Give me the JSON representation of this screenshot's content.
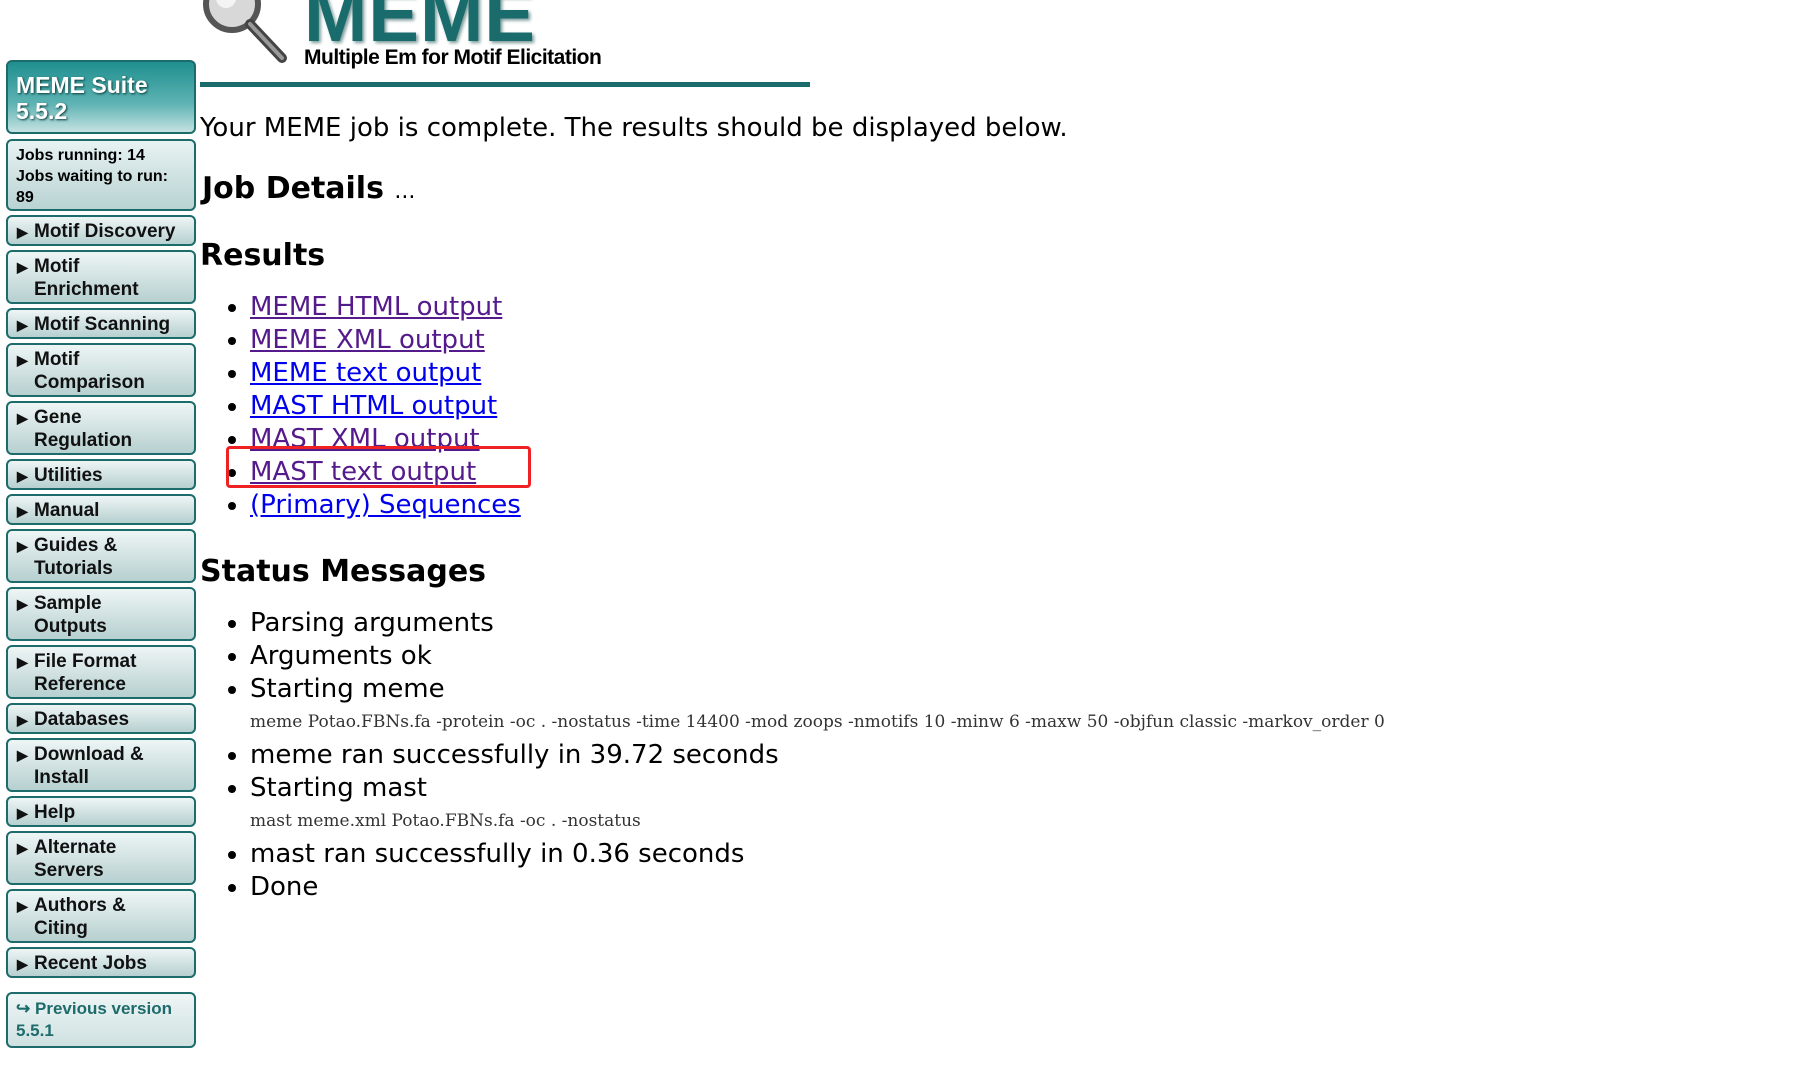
{
  "header": {
    "logo_text": "MEME",
    "logo_subtitle": "Multiple Em for Motif Elicitation"
  },
  "sidebar": {
    "title_line1": "MEME Suite",
    "title_line2": "5.5.2",
    "jobs_running": "Jobs running: 14",
    "jobs_waiting": "Jobs waiting to run: 89",
    "items": [
      {
        "line1": "Motif Discovery",
        "line2": ""
      },
      {
        "line1": "Motif",
        "line2": "Enrichment"
      },
      {
        "line1": "Motif Scanning",
        "line2": ""
      },
      {
        "line1": "Motif",
        "line2": "Comparison"
      },
      {
        "line1": "Gene",
        "line2": "Regulation"
      },
      {
        "line1": "Utilities",
        "line2": ""
      },
      {
        "line1": "Manual",
        "line2": ""
      },
      {
        "line1": "Guides &",
        "line2": "Tutorials"
      },
      {
        "line1": "Sample",
        "line2": "Outputs"
      },
      {
        "line1": "File Format",
        "line2": "Reference"
      },
      {
        "line1": "Databases",
        "line2": ""
      },
      {
        "line1": "Download &",
        "line2": "Install"
      },
      {
        "line1": "Help",
        "line2": ""
      },
      {
        "line1": "Alternate",
        "line2": "Servers"
      },
      {
        "line1": "Authors &",
        "line2": "Citing"
      },
      {
        "line1": "Recent Jobs",
        "line2": ""
      }
    ],
    "arrow": "▶",
    "previous_icon": "↪",
    "previous_line1": "Previous version",
    "previous_line2": "5.5.1"
  },
  "main": {
    "intro": "Your MEME job is complete. The results should be displayed below.",
    "job_details_heading": "Job Details",
    "job_details_dots": "...",
    "results_heading": "Results",
    "results": [
      {
        "label": "MEME HTML output",
        "visited": true
      },
      {
        "label": "MEME XML output",
        "visited": true
      },
      {
        "label": "MEME text output",
        "visited": false
      },
      {
        "label": "MAST HTML output",
        "visited": false
      },
      {
        "label": "MAST XML output",
        "visited": true
      },
      {
        "label": "MAST text output",
        "visited": true
      },
      {
        "label": "(Primary) Sequences",
        "visited": false
      }
    ],
    "status_heading": "Status Messages",
    "status": {
      "s1": "Parsing arguments",
      "s2": "Arguments ok",
      "s3": "Starting meme",
      "cmd1": "meme Potao.FBNs.fa -protein -oc . -nostatus -time 14400 -mod zoops -nmotifs 10 -minw 6 -maxw 50 -objfun classic -markov_order 0",
      "s4": "meme ran successfully in 39.72 seconds",
      "s5": "Starting mast",
      "cmd2": "mast meme.xml Potao.FBNs.fa -oc . -nostatus",
      "s6": "mast ran successfully in 0.36 seconds",
      "s7": "Done"
    }
  },
  "colors": {
    "brand_teal": "#1a6b6b",
    "link": "#0000ee",
    "link_visited": "#551a8b",
    "highlight_box": "#ee2222"
  }
}
